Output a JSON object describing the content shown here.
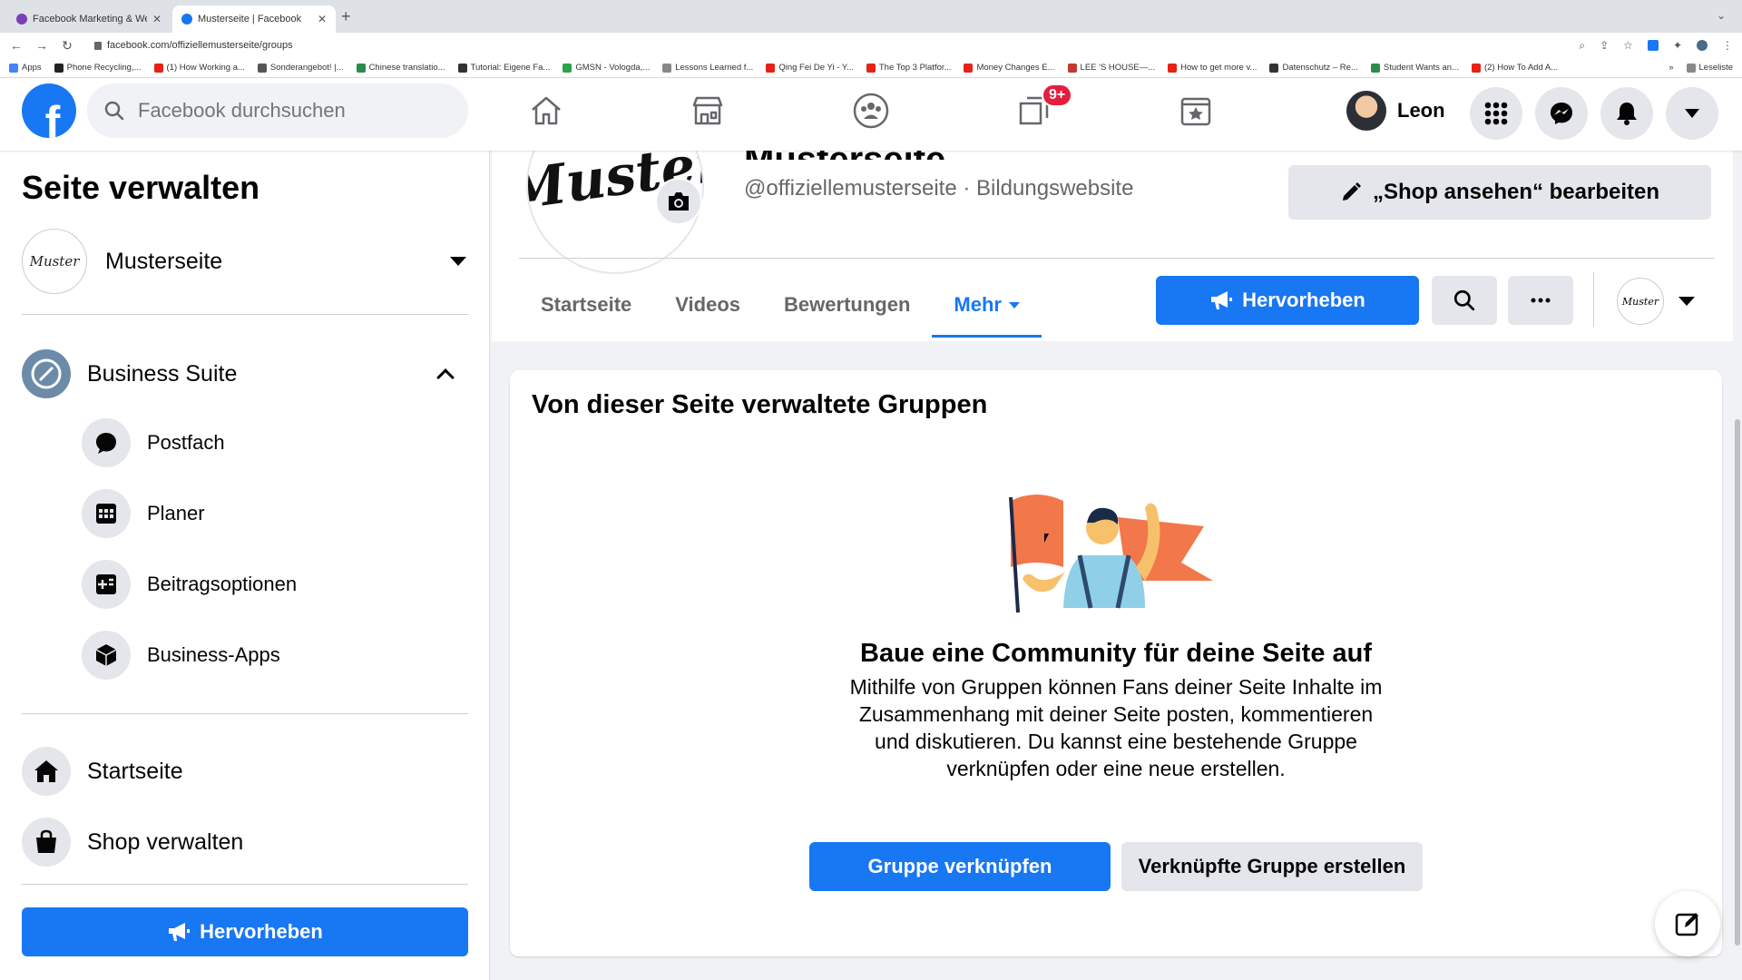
{
  "browser": {
    "tabs": [
      {
        "label": "Facebook Marketing & Werbe",
        "color": "#7b3fb8"
      },
      {
        "label": "Musterseite | Facebook",
        "color": "#1877f2"
      }
    ],
    "url": "facebook.com/offiziellemusterseite/groups",
    "bookmarks": [
      {
        "label": "Apps",
        "color": "#4285f4"
      },
      {
        "label": "Phone Recycling,...",
        "color": "#222222"
      },
      {
        "label": "(1) How Working a...",
        "color": "#e62117"
      },
      {
        "label": "Sonderangebot! |...",
        "color": "#555555"
      },
      {
        "label": "Chinese translatio...",
        "color": "#2a8c4a"
      },
      {
        "label": "Tutorial: Eigene Fa...",
        "color": "#333333"
      },
      {
        "label": "GMSN - Vologda,...",
        "color": "#2aa34a"
      },
      {
        "label": "Lessons Learned f...",
        "color": "#888888"
      },
      {
        "label": "Qing Fei De Yi - Y...",
        "color": "#e62117"
      },
      {
        "label": "The Top 3 Platfor...",
        "color": "#e62117"
      },
      {
        "label": "Money Changes E...",
        "color": "#e62117"
      },
      {
        "label": "LEE 'S HOUSE—...",
        "color": "#c0392b"
      },
      {
        "label": "How to get more v...",
        "color": "#e62117"
      },
      {
        "label": "Datenschutz – Re...",
        "color": "#333333"
      },
      {
        "label": "Student Wants an...",
        "color": "#2a8c4a"
      },
      {
        "label": "(2) How To Add A...",
        "color": "#e62117"
      }
    ],
    "more_bookmarks": "»",
    "reading_list": "Leseliste"
  },
  "header": {
    "logo": "f",
    "search_placeholder": "Facebook durchsuchen",
    "badge": "9+",
    "user_name": "Leon"
  },
  "sidebar": {
    "title": "Seite verwalten",
    "page_name": "Musterseite",
    "page_logo_text": "Muster",
    "suite_label": "Business Suite",
    "suite_items": [
      {
        "label": "Postfach",
        "icon": "chat-bubble-icon"
      },
      {
        "label": "Planer",
        "icon": "calendar-grid-icon"
      },
      {
        "label": "Beitragsoptionen",
        "icon": "post-options-icon"
      },
      {
        "label": "Business-Apps",
        "icon": "cube-icon"
      }
    ],
    "main_items": [
      {
        "label": "Startseite",
        "icon": "home-icon"
      },
      {
        "label": "Shop verwalten",
        "icon": "shopping-bag-icon"
      }
    ],
    "promote_label": "Hervorheben"
  },
  "page": {
    "name": "Musterseite",
    "logo_text": "Muster",
    "handle": "@offiziellemusterseite · Bildungswebsite",
    "shop_button": "„Shop ansehen“ bearbeiten",
    "tabs": [
      "Startseite",
      "Videos",
      "Bewertungen",
      "Mehr"
    ],
    "active_tab": "Mehr",
    "promote_label": "Hervorheben"
  },
  "groups_card": {
    "title": "Von dieser Seite verwaltete Gruppen",
    "cta_title": "Baue eine Community für deine Seite auf",
    "cta_desc": "Mithilfe von Gruppen können Fans deiner Seite Inhalte im Zusammenhang mit deiner Seite posten, kommentieren und diskutieren. Du kannst eine bestehende Gruppe verknüpfen oder eine neue erstellen.",
    "link_button": "Gruppe verknüpfen",
    "create_button": "Verknüpfte Gruppe erstellen"
  },
  "colors": {
    "brand": "#1877f2",
    "badge": "#e41e3f",
    "background": "#f0f2f5"
  }
}
